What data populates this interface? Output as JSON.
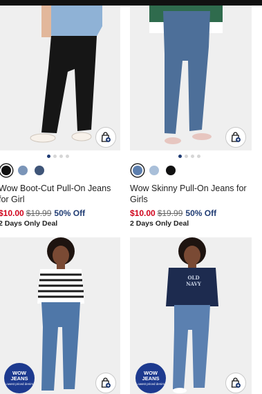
{
  "products": [
    {
      "name": "Wow Boot-Cut Pull-On Jeans for Girl",
      "price_sale": "$10.00",
      "price_original": "$19.99",
      "discount": "50% Off",
      "deal": "2 Days Only Deal",
      "swatches": [
        "#111111",
        "#7b95b8",
        "#3f5578"
      ],
      "selected_swatch": 0
    },
    {
      "name": "Wow Skinny Pull-On Jeans for Girls",
      "price_sale": "$10.00",
      "price_original": "$19.99",
      "discount": "50% Off",
      "deal": "2 Days Only Deal",
      "swatches": [
        "#5d7fae",
        "#a9bfd9",
        "#111111"
      ],
      "selected_swatch": 0
    },
    {
      "badge_line1": "WOW",
      "badge_line2": "JEANS",
      "badge_line3": "Lowest priced denim."
    },
    {
      "badge_line1": "WOW",
      "badge_line2": "JEANS",
      "badge_line3": "Lowest priced denim.",
      "sweater_text": "OLD NAVY"
    }
  ],
  "icons": {
    "bag": "shopping-bag-add-icon"
  },
  "colors": {
    "sale": "#d0021b",
    "discount": "#1f3b73",
    "badge": "#1d3a8f"
  }
}
